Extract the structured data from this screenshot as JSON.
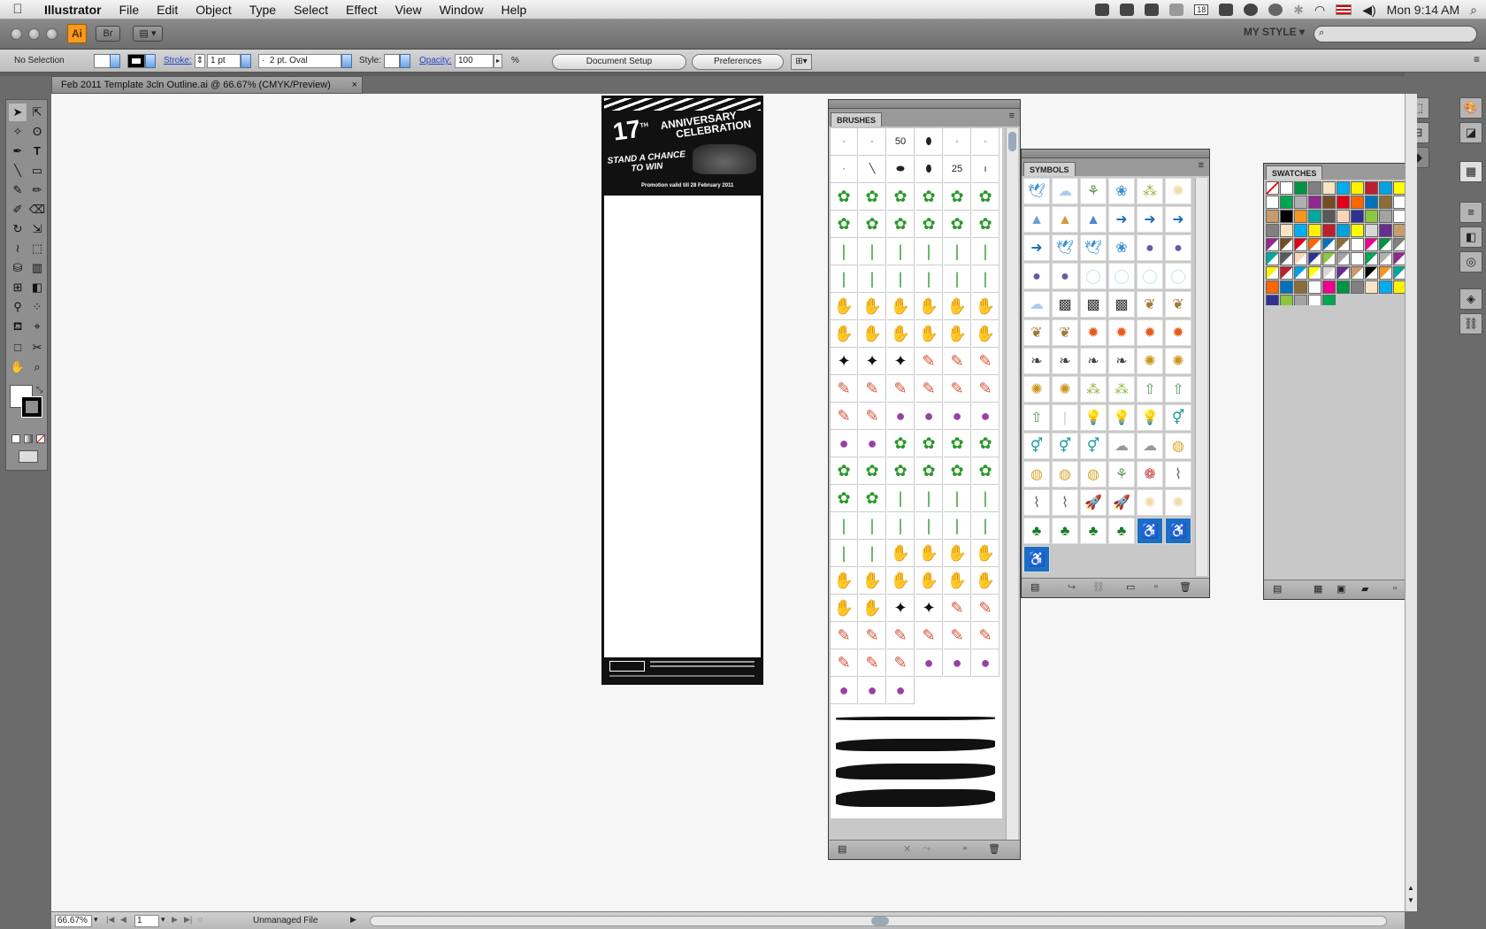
{
  "menubar": {
    "app_name": "Illustrator",
    "items": [
      "File",
      "Edit",
      "Object",
      "Type",
      "Select",
      "Effect",
      "View",
      "Window",
      "Help"
    ],
    "calendar_day": "18",
    "clock": "Mon 9:14 AM"
  },
  "appbar": {
    "logo": "Ai",
    "bridge_label": "Br",
    "workspace": "MY STYLE"
  },
  "control": {
    "selection": "No Selection",
    "stroke_label": "Stroke:",
    "stroke_value": "1 pt",
    "brush_value": "2 pt. Oval",
    "style_label": "Style:",
    "opacity_label": "Opacity:",
    "opacity_value": "100",
    "opacity_unit": "%",
    "document_setup": "Document Setup",
    "preferences": "Preferences"
  },
  "document_tab": {
    "title": "Feb 2011 Template 3cln Outline.ai @ 66.67% (CMYK/Preview)",
    "close": "×"
  },
  "artboard": {
    "line1": "17",
    "line1_sup": "TH",
    "line2": "ANNIVERSARY",
    "line3": "CELEBRATION",
    "line4": "STAND A CHANCE",
    "line5": "TO WIN",
    "promo": "Promotion valid till 28 February 2011"
  },
  "brushes": {
    "title": "BRUSHES",
    "calligraphic_row1": [
      "·",
      "·",
      "50",
      "⬮",
      "·",
      "·"
    ],
    "calligraphic_row2": [
      "·",
      "╲",
      "⬬",
      "⬮",
      "25",
      "ı"
    ]
  },
  "symbols": {
    "title": "SYMBOLS"
  },
  "swatches": {
    "title": "SWATCHES",
    "colors": [
      "#ffffff",
      "#000000",
      "#e0001a",
      "#ffff00",
      "#00a650",
      "#00aeef",
      "#2e3192",
      "#ec008c",
      "#f7941d",
      "#ff6600",
      "#d8d8d8",
      "#b0b0b0",
      "#fff200",
      "#8dc63f",
      "#009444",
      "#00a99d",
      "#0072bc",
      "#662d91",
      "#92278f",
      "#be1e2d",
      "#a3a3a3",
      "#808080",
      "#595959",
      "#8a6d3b",
      "#c69c6d",
      "#754c24",
      "#00a2e0",
      "#ffffff",
      "#f7e4c3",
      "#fbd5b5"
    ]
  },
  "status": {
    "zoom": "66.67%",
    "page": "1",
    "info": "Unmanaged File"
  }
}
